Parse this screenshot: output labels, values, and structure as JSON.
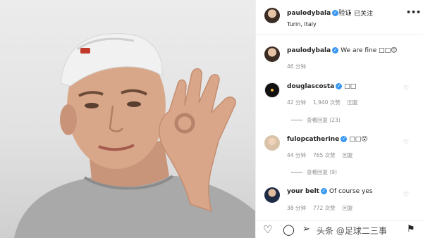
{
  "post": {
    "username": "paulodybala",
    "verified_badge": "✓",
    "verified_text": "验证",
    "follow_label": "• 已关注",
    "location": "Turin, Italy",
    "more_icon": "more-horizontal-icon"
  },
  "caption": {
    "username": "paulodybala",
    "text": "We are fine □□😊",
    "time": "46 分钟"
  },
  "comments": [
    {
      "username": "douglascosta",
      "text": "□□",
      "time": "42 分钟",
      "likes": "1,940 次赞",
      "reply_label": "回复",
      "view_replies": "查看回复 (23)"
    },
    {
      "username": "fulopcatherine",
      "text": "□□😮",
      "time": "44 分钟",
      "likes": "765 次赞",
      "reply_label": "回复",
      "view_replies": "查看回复 (9)"
    },
    {
      "username": "your belt",
      "text": "Of course yes",
      "time": "38 分钟",
      "likes": "772 次赞",
      "reply_label": "回复"
    }
  ],
  "actions": {
    "like_icon": "heart-icon",
    "comment_icon": "comment-icon",
    "share_icon": "paper-plane-icon",
    "save_icon": "bookmark-icon"
  },
  "watermark": "头条 @足球二三事",
  "colors": {
    "verified_blue": "#3897f0",
    "meta_gray": "#8e8e8e",
    "text_dark": "#262626"
  }
}
